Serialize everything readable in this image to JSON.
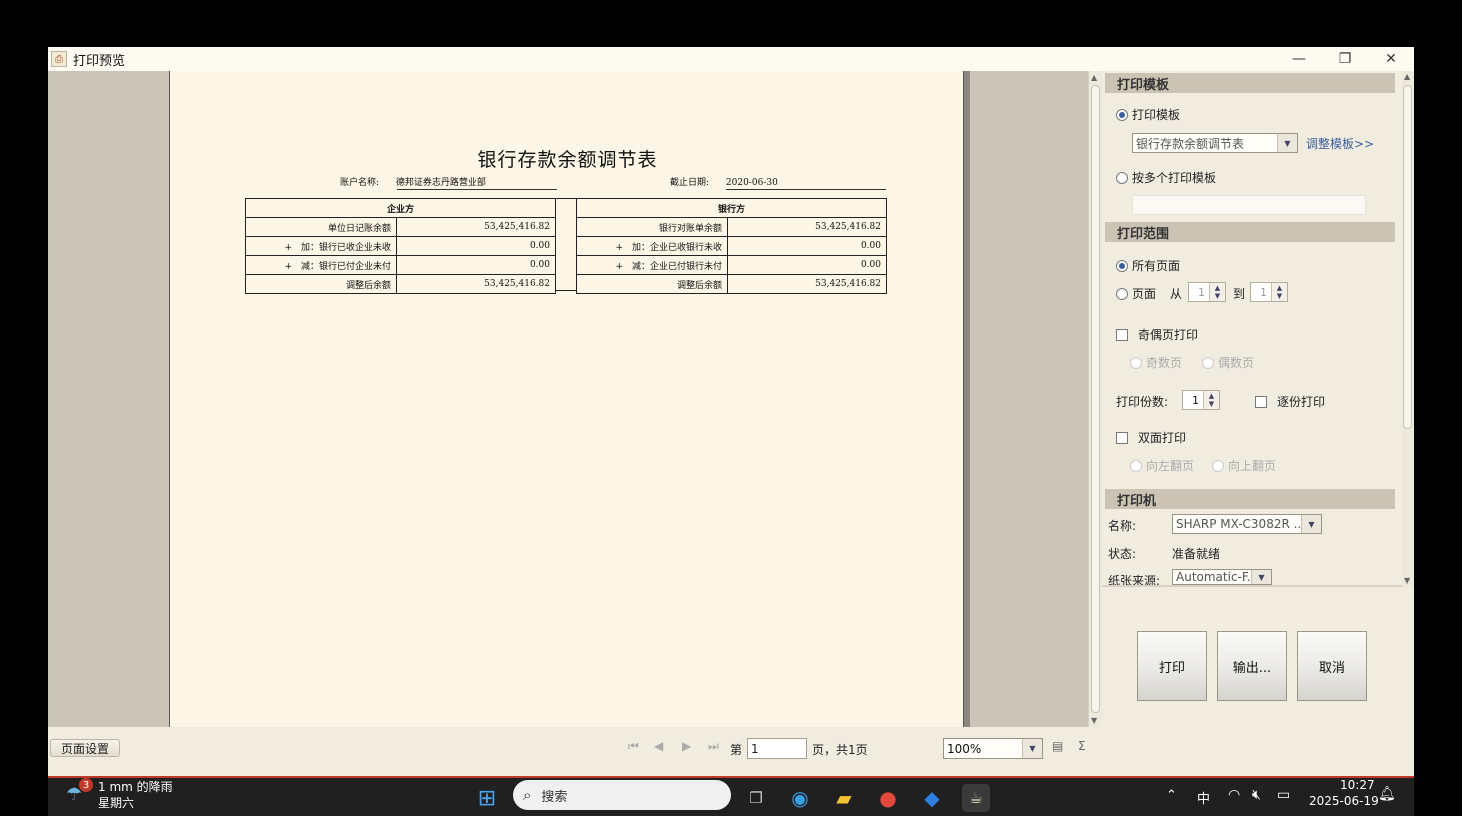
{
  "window": {
    "title": "打印预览",
    "app_icon": "printer-app-icon",
    "minimize": "—",
    "restore": "❐",
    "close": "✕"
  },
  "document": {
    "title": "银行存款余额调节表",
    "account_label": "账户名称:",
    "account_value": "德邦证券志丹路营业部",
    "date_label": "截止日期:",
    "date_value": "2020-06-30",
    "company_header": "企业方",
    "bank_header": "银行方",
    "rows": [
      {
        "left_label": "单位日记账余额",
        "left_value": "53,425,416.82",
        "right_label": "银行对账单余额",
        "right_value": "53,425,416.82"
      },
      {
        "left_label": "+　加：银行已收企业未收",
        "left_value": "0.00",
        "right_label": "+　加：企业已收银行未收",
        "right_value": "0.00"
      },
      {
        "left_label": "+　减：银行已付企业未付",
        "left_value": "0.00",
        "right_label": "+　减：企业已付银行未付",
        "right_value": "0.00"
      },
      {
        "left_label": "调整后余额",
        "left_value": "53,425,416.82",
        "right_label": "调整后余额",
        "right_value": "53,425,416.82"
      }
    ]
  },
  "bottom": {
    "page_setup": "页面设置",
    "page_prefix": "第",
    "page_value": "1",
    "page_suffix": "页，共1页",
    "zoom": "100%"
  },
  "sidebar": {
    "template_section": "打印模板",
    "template_radio": "打印模板",
    "template_select": "银行存款余额调节表",
    "adjust_link": "调整模板>>",
    "multi_template_radio": "按多个打印模板",
    "range_section": "打印范围",
    "all_pages": "所有页面",
    "pages": "页面",
    "from": "从",
    "from_value": "1",
    "to": "到",
    "to_value": "1",
    "odd_even": "奇偶页打印",
    "odd": "奇数页",
    "even": "偶数页",
    "copies_label": "打印份数:",
    "copies_value": "1",
    "collate": "逐份打印",
    "duplex": "双面打印",
    "flip_left": "向左翻页",
    "flip_up": "向上翻页",
    "printer_section": "打印机",
    "name_label": "名称:",
    "printer_name": "SHARP MX-C3082R ...",
    "status_label": "状态:",
    "status_value": "准备就绪",
    "source_label": "纸张来源:",
    "source_value": "Automatic-F...",
    "print_btn": "打印",
    "export_btn": "输出...",
    "cancel_btn": "取消"
  },
  "taskbar": {
    "weather_badge": "3",
    "weather_text": "1 mm 的降雨",
    "weather_day": "星期六",
    "search": "搜索",
    "ime": "中",
    "time": "10:27",
    "date": "2025-06-19"
  }
}
